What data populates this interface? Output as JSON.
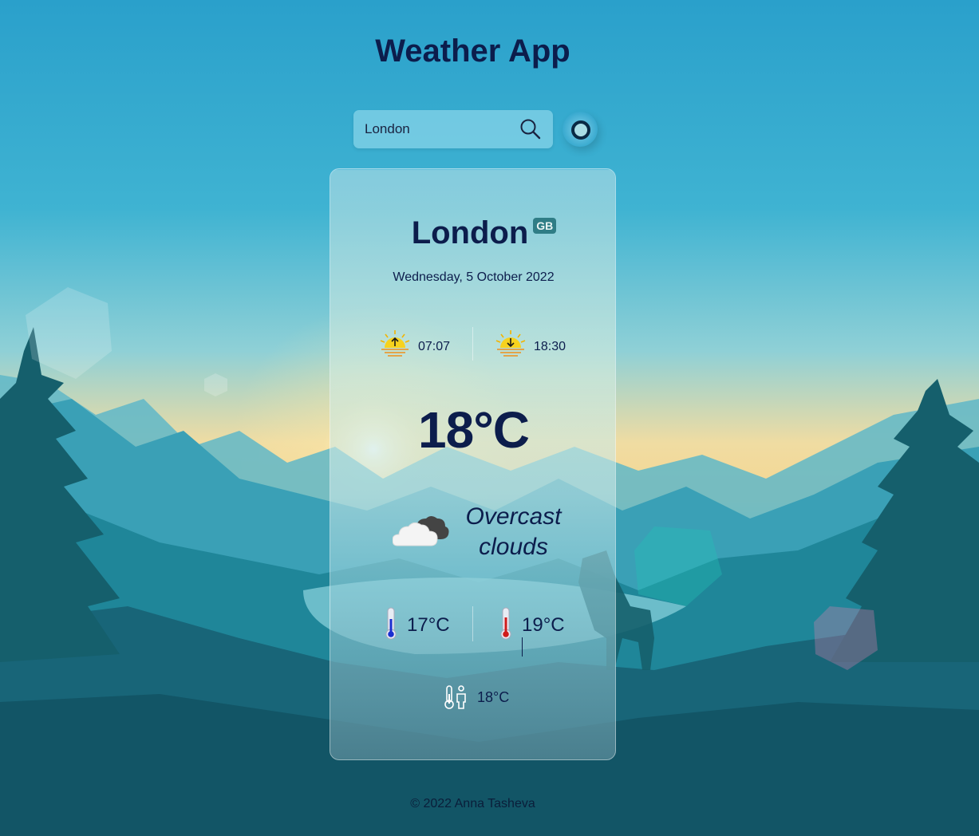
{
  "header": {
    "title": "Weather App"
  },
  "search": {
    "value": "London",
    "placeholder": ""
  },
  "weather": {
    "city": "London",
    "country": "GB",
    "date": "Wednesday, 5 October 2022",
    "sunrise": "07:07",
    "sunset": "18:30",
    "temperature": "18°C",
    "condition_line1": "Overcast",
    "condition_line2": "clouds",
    "temp_min": "17°C",
    "temp_max": "19°C",
    "feels_like": "18°C"
  },
  "icons": {
    "search": "search-icon",
    "location": "location-icon",
    "sunrise": "sunrise-icon",
    "sunset": "sunset-icon",
    "condition": "overcast-clouds-icon",
    "temp_min": "thermometer-cold-icon",
    "temp_max": "thermometer-hot-icon",
    "feels_like": "feels-like-icon"
  },
  "colors": {
    "text": "#0c1d4c",
    "badge": "#2f7d86",
    "sky_top": "#2ba3cc",
    "horizon": "#f3d99c",
    "foreground": "#155a6c"
  },
  "footer": {
    "text": "© 2022 Anna Tasheva"
  }
}
